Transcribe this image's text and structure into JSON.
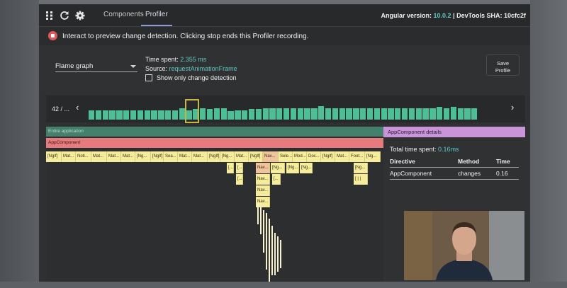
{
  "toolbar": {
    "icons": [
      "apps-grid-icon",
      "refresh-icon",
      "gear-icon"
    ],
    "tabs": [
      {
        "label": "Components",
        "active": false
      },
      {
        "label": "Profiler",
        "active": true
      }
    ],
    "version_label": "Angular version:",
    "version_value": "10.0.2",
    "separator": "|",
    "sha_label": "DevTools SHA:",
    "sha_value": "10cfc2f"
  },
  "banner": {
    "text": "Interact to preview change detection. Clicking stop ends this Profiler recording."
  },
  "controls": {
    "view_select": "Flame graph",
    "time_spent_label": "Time spent:",
    "time_spent_value": "2.355 ms",
    "source_label": "Source:",
    "source_value": "requestAnimationFrame",
    "checkbox_label": "Show only change detection",
    "checkbox_checked": false,
    "save_label_1": "Save",
    "save_label_2": "Profile"
  },
  "timeline": {
    "frame_counter": "42 / ...",
    "bar_levels": [
      0.45,
      0.45,
      0.45,
      0.45,
      0.45,
      0.45,
      0.45,
      0.45,
      0.45,
      0.45,
      0.45,
      0.45,
      0.45,
      0.55,
      0.45,
      0.5,
      0.55,
      0.5,
      0.55,
      0.55,
      0.4,
      0.45,
      0.45,
      0.5,
      0.5,
      0.55,
      0.55,
      0.55,
      0.55,
      0.55,
      0.55,
      0.55,
      0.55,
      0.65,
      0.55,
      0.55,
      0.55,
      0.55,
      0.55,
      0.55,
      0.55,
      0.55,
      0.55,
      0.55,
      0.55,
      0.55,
      0.55,
      0.55,
      0.55,
      0.55,
      0.6,
      0.55,
      0.6,
      0.55,
      0.55,
      0.55
    ],
    "selected_index": 14,
    "bar_color": "#4dbf97",
    "selected_color": "#c8b547"
  },
  "flame": {
    "root_label": "Entire application",
    "app_label": "AppComponent",
    "row1": [
      "[NgIf]",
      "Mat...",
      "Noti...",
      "Mat...",
      "Mat...",
      "Mat...",
      "[Ng...",
      "[NgIf]",
      "Sea...",
      "Mat...",
      "Mat...",
      "[NgIf]",
      "[Ng...",
      "Mat...",
      "[NgIf]",
      "Nav...",
      "Sele...",
      "Mod...",
      "Doc...",
      "[NgIf]",
      "Mat...",
      "Foot...",
      "[Ng..."
    ],
    "row2": [
      "[...",
      "[...",
      "Nav...",
      "[Ng...",
      "[Ng...",
      "[Ng...",
      "[Ng..."
    ],
    "row3": [
      "[...",
      "Nav...",
      "[...",
      "[ | |"
    ],
    "row4": [
      "Nav..."
    ],
    "row5": [
      "Nav..."
    ],
    "colors": {
      "root": "#45806c",
      "app": "#e77a7c",
      "cell": "#f5ec9c",
      "highlight": "#f1c39b"
    }
  },
  "details": {
    "title": "AppComponent details",
    "total_label": "Total time spent:",
    "total_value": "0.16ms",
    "headers": [
      "Directive",
      "Method",
      "Time"
    ],
    "rows": [
      [
        "AppComponent",
        "changes",
        "0.16"
      ]
    ]
  }
}
